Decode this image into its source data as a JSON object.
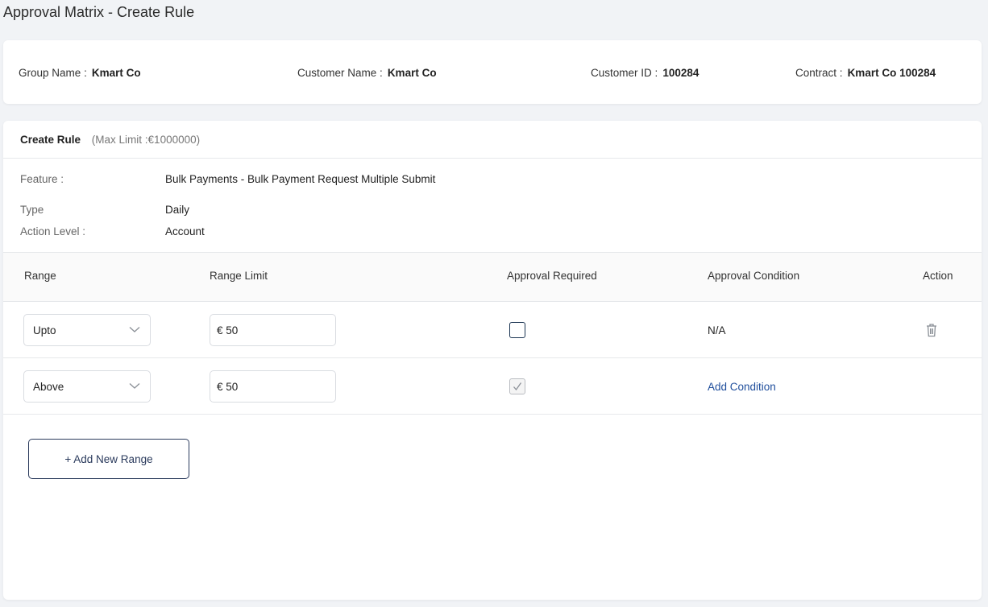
{
  "page": {
    "title": "Approval Matrix - Create Rule"
  },
  "info": {
    "group_name_label": "Group Name",
    "group_name_value": "Kmart Co",
    "customer_name_label": "Customer Name",
    "customer_name_value": "Kmart Co",
    "customer_id_label": "Customer ID",
    "customer_id_value": "100284",
    "contract_label": "Contract",
    "contract_value": "Kmart Co 100284",
    "colon": ":"
  },
  "rule": {
    "title": "Create Rule",
    "max_limit": "(Max Limit :€1000000)",
    "feature_label": "Feature :",
    "feature_value": "Bulk Payments - Bulk Payment Request Multiple Submit",
    "type_label": "Type",
    "type_value": "Daily",
    "action_level_label": "Action Level :",
    "action_level_value": "Account"
  },
  "table": {
    "headers": {
      "range": "Range",
      "range_limit": "Range Limit",
      "approval_required": "Approval Required",
      "approval_condition": "Approval Condition",
      "action": "Action"
    },
    "rows": [
      {
        "range": "Upto",
        "limit": "€ 50",
        "approval_required": false,
        "condition": "N/A",
        "has_delete": true
      },
      {
        "range": "Above",
        "limit": "€ 50",
        "approval_required": true,
        "condition": "Add Condition",
        "has_delete": false
      }
    ]
  },
  "buttons": {
    "add_range": "+ Add New Range"
  },
  "colors": {
    "accent": "#1f4e9c",
    "button_border": "#2a3a5c",
    "page_bg": "#f1f3f6"
  },
  "icons": {
    "select_chevron": "chevron-down-icon",
    "delete": "trash-icon",
    "check": "checkmark-icon"
  }
}
